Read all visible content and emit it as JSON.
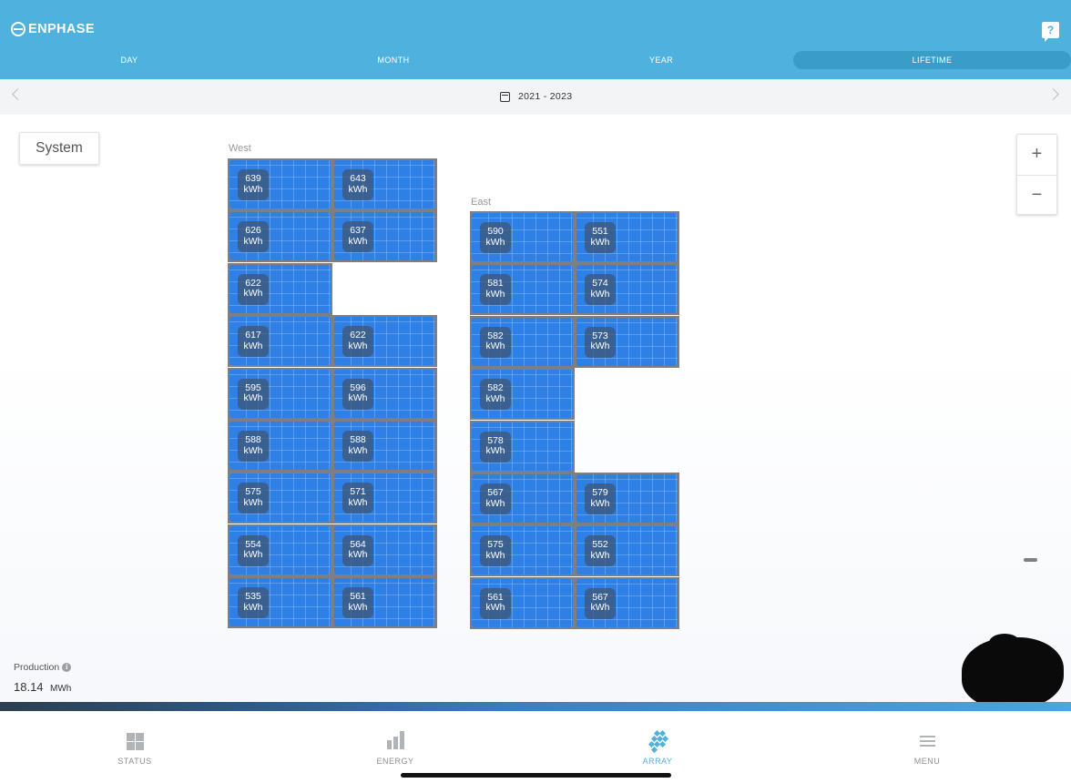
{
  "header": {
    "brand": "ENPHASE",
    "help_label": "?",
    "tabs": [
      {
        "label": "DAY",
        "active": false
      },
      {
        "label": "MONTH",
        "active": false
      },
      {
        "label": "YEAR",
        "active": false
      },
      {
        "label": "LIFETIME",
        "active": true
      }
    ]
  },
  "datebar": {
    "range": "2021 - 2023"
  },
  "main": {
    "system_label": "System",
    "zoom_in_label": "+",
    "zoom_out_label": "−",
    "groups": [
      {
        "name": "West",
        "panels": [
          {
            "value": "639",
            "unit": "kWh"
          },
          {
            "value": "643",
            "unit": "kWh"
          },
          {
            "value": "626",
            "unit": "kWh"
          },
          {
            "value": "637",
            "unit": "kWh"
          },
          {
            "value": "622",
            "unit": "kWh"
          },
          {
            "value": "617",
            "unit": "kWh"
          },
          {
            "value": "622",
            "unit": "kWh"
          },
          {
            "value": "595",
            "unit": "kWh"
          },
          {
            "value": "596",
            "unit": "kWh"
          },
          {
            "value": "588",
            "unit": "kWh"
          },
          {
            "value": "588",
            "unit": "kWh"
          },
          {
            "value": "575",
            "unit": "kWh"
          },
          {
            "value": "571",
            "unit": "kWh"
          },
          {
            "value": "554",
            "unit": "kWh"
          },
          {
            "value": "564",
            "unit": "kWh"
          },
          {
            "value": "535",
            "unit": "kWh"
          },
          {
            "value": "561",
            "unit": "kWh"
          }
        ]
      },
      {
        "name": "East",
        "panels": [
          {
            "value": "590",
            "unit": "kWh"
          },
          {
            "value": "551",
            "unit": "kWh"
          },
          {
            "value": "581",
            "unit": "kWh"
          },
          {
            "value": "574",
            "unit": "kWh"
          },
          {
            "value": "582",
            "unit": "kWh"
          },
          {
            "value": "573",
            "unit": "kWh"
          },
          {
            "value": "582",
            "unit": "kWh"
          },
          {
            "value": "578",
            "unit": "kWh"
          },
          {
            "value": "567",
            "unit": "kWh"
          },
          {
            "value": "579",
            "unit": "kWh"
          },
          {
            "value": "575",
            "unit": "kWh"
          },
          {
            "value": "552",
            "unit": "kWh"
          },
          {
            "value": "561",
            "unit": "kWh"
          },
          {
            "value": "567",
            "unit": "kWh"
          }
        ]
      }
    ],
    "production": {
      "label": "Production",
      "value": "18.14",
      "unit": "MWh"
    }
  },
  "bottom_nav": [
    {
      "label": "STATUS",
      "icon": "grid-icon",
      "active": false
    },
    {
      "label": "ENERGY",
      "icon": "bar-chart-icon",
      "active": false
    },
    {
      "label": "ARRAY",
      "icon": "array-icon",
      "active": true
    },
    {
      "label": "MENU",
      "icon": "hamburger-icon",
      "active": false
    }
  ],
  "colors": {
    "header": "#4fb2de",
    "panel": "#2f80e6",
    "accent": "#4fb2de"
  }
}
